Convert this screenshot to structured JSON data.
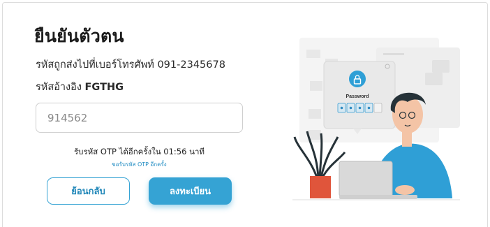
{
  "verify": {
    "title": "ยืนยันตัวตน",
    "sent_to": "รหัสถูกส่งไปที่เบอร์โทรศัพท์ 091-2345678",
    "ref_label": "รหัสอ้างอิง",
    "ref_code": "FGTHG",
    "otp_value": "914562",
    "resend_countdown": "รับรหัส OTP ได้อีกครั้งใน 01:56 นาที",
    "resend_link": "ขอรับรหัส OTP อีกครั้ง",
    "back_label": "ย้อนกลับ",
    "register_label": "ลงทะเบียน"
  },
  "illustration": {
    "popup_title": "Password",
    "icon": "lock-icon"
  },
  "colors": {
    "accent": "#35a3d4",
    "link": "#1f8bc2",
    "shirt": "#2f9fd6",
    "pot": "#e0553b"
  }
}
